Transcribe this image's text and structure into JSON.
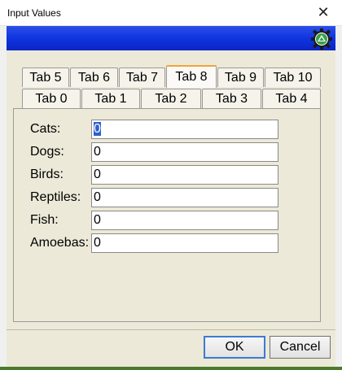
{
  "window": {
    "title": "Input Values",
    "close_glyph": "✕"
  },
  "colors": {
    "banner": "#1538e0",
    "accent": "#f2a23a",
    "selection": "#2f60d0"
  },
  "tabs": {
    "back_row": [
      "Tab 5",
      "Tab 6",
      "Tab 7",
      "Tab 8",
      "Tab 9",
      "Tab 10"
    ],
    "front_row": [
      "Tab 0",
      "Tab 1",
      "Tab 2",
      "Tab 3",
      "Tab 4"
    ],
    "selected": "Tab 8"
  },
  "fields": [
    {
      "label": "Cats:",
      "value": "0"
    },
    {
      "label": "Dogs:",
      "value": "0"
    },
    {
      "label": "Birds:",
      "value": "0"
    },
    {
      "label": "Reptiles:",
      "value": "0"
    },
    {
      "label": "Fish:",
      "value": "0"
    },
    {
      "label": "Amoebas:",
      "value": "0"
    }
  ],
  "buttons": {
    "ok": "OK",
    "cancel": "Cancel"
  },
  "icons": {
    "banner_icon": "gear-icon"
  }
}
